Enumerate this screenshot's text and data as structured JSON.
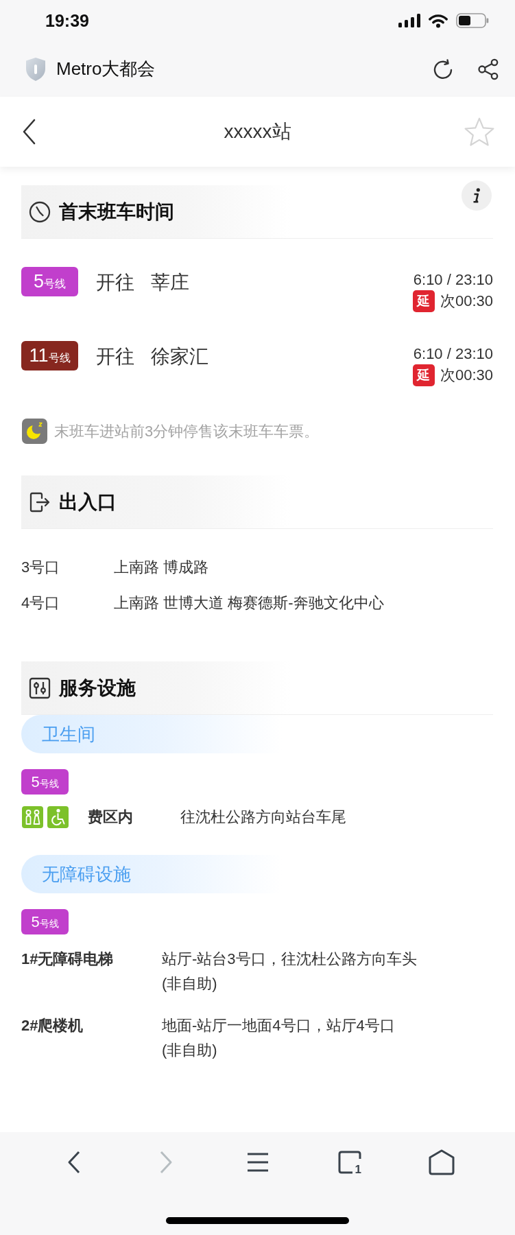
{
  "status_bar": {
    "time": "19:39"
  },
  "browser_bar": {
    "site_name": "Metro大都会"
  },
  "header": {
    "title": "xxxxx站",
    "favorited": false
  },
  "first_last_trains": {
    "title": "首末班车时间",
    "rows": [
      {
        "line": {
          "number": "5",
          "unit": "号线",
          "color": "#c13fcc"
        },
        "direction": "开往",
        "destination": "莘庄",
        "times": "6:10 / 23:10",
        "delay_tag": "延",
        "last_time": "次00:30"
      },
      {
        "line": {
          "number": "11",
          "unit": "号线",
          "color": "#87271f"
        },
        "direction": "开往",
        "destination": "徐家汇",
        "times": "6:10 / 23:10",
        "delay_tag": "延",
        "last_time": "次00:30"
      }
    ],
    "note": "末班车进站前3分钟停售该末班车车票。"
  },
  "exits": {
    "title": "出入口",
    "items": [
      {
        "name": "3号口",
        "roads": "上南路 博成路"
      },
      {
        "name": "4号口",
        "roads": "上南路 世博大道 梅赛德斯-奔驰文化中心"
      }
    ]
  },
  "facilities": {
    "title": "服务设施",
    "groups": [
      {
        "title": "卫生间",
        "line": {
          "number": "5",
          "unit": "号线",
          "color": "#c13fcc"
        },
        "items": [
          {
            "kind": "toilet",
            "area": "费区内",
            "location": "往沈杜公路方向站台车尾"
          }
        ]
      },
      {
        "title": "无障碍设施",
        "line": {
          "number": "5",
          "unit": "号线",
          "color": "#c13fcc"
        },
        "items": [
          {
            "kind": "device",
            "name": "1#无障碍电梯",
            "description": "站厅-站台3号口，往沈杜公路方向车头\n(非自助)"
          },
          {
            "kind": "device",
            "name": "2#爬楼机",
            "description": "地面-站厅一地面4号口，站厅4号口\n(非自助)"
          }
        ]
      }
    ]
  },
  "toolbar": [
    {
      "kind": "back",
      "disabled": false
    },
    {
      "kind": "forward",
      "disabled": true
    },
    {
      "kind": "menu",
      "disabled": false
    },
    {
      "kind": "tabs",
      "disabled": false,
      "count": "1"
    },
    {
      "kind": "home",
      "disabled": false
    }
  ]
}
